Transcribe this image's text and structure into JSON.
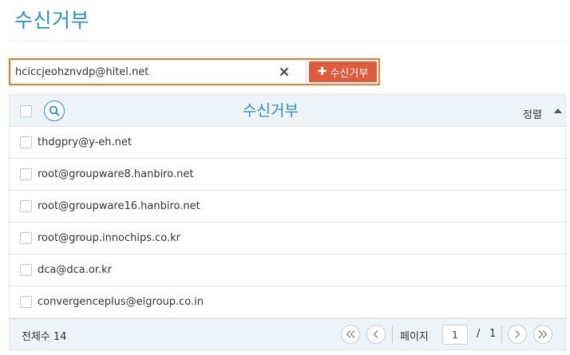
{
  "page": {
    "title": "수신거부"
  },
  "form": {
    "email_value": "hciccjeohznvdp@hitel.net",
    "clear_icon": "close-icon",
    "add_button_icon": "plus-icon",
    "add_button_label": "수신거부",
    "accent_color": "#e05a3c",
    "focus_border_color": "#f07a2a"
  },
  "list": {
    "heading": "수신거부",
    "search_icon": "search-icon",
    "sort_label": "정렬",
    "sort_direction": "ascending",
    "items": [
      {
        "email": "thdgpry@y-eh.net"
      },
      {
        "email": "root@groupware8.hanbiro.net"
      },
      {
        "email": "root@groupware16.hanbiro.net"
      },
      {
        "email": "root@group.innochips.co.kr"
      },
      {
        "email": "dca@dca.or.kr"
      },
      {
        "email": "convergenceplus@eigroup.co.in"
      }
    ]
  },
  "footer": {
    "total_label": "전체수",
    "total_count": "14",
    "page_label": "페이지",
    "current_page": "1",
    "slash": "/",
    "total_pages": "1"
  },
  "colors": {
    "brand_blue": "#2a8fc5",
    "header_bg": "#eef3f8"
  }
}
